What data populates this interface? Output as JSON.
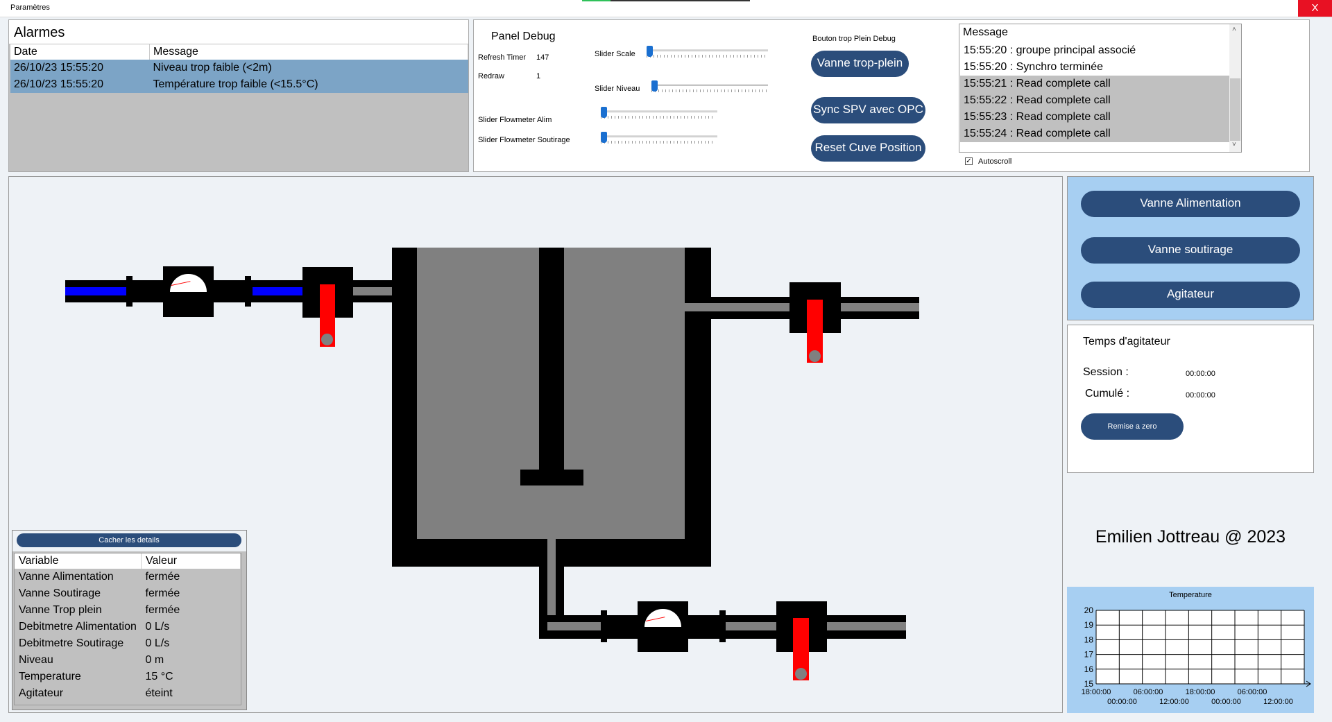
{
  "window": {
    "title": "Paramètres",
    "close_label": "X",
    "progress": 0.17
  },
  "alarms": {
    "title": "Alarmes",
    "columns": [
      "Date",
      "Message"
    ],
    "rows": [
      {
        "date": "26/10/23 15:55:20",
        "message": "Niveau trop faible (<2m)"
      },
      {
        "date": "26/10/23 15:55:20",
        "message": "Température trop faible (<15.5°C)"
      }
    ]
  },
  "debug": {
    "title": "Panel Debug",
    "refresh_timer_label": "Refresh Timer",
    "refresh_timer_value": "147",
    "redraw_label": "Redraw",
    "redraw_value": "1",
    "slider_scale_label": "Slider Scale",
    "slider_niveau_label": "Slider Niveau",
    "slider_alim_label": "Slider Flowmeter Alim",
    "slider_soutirage_label": "Slider Flowmeter Soutirage",
    "overflow_debug_label": "Bouton trop Plein Debug",
    "btn_overflow": "Vanne trop-plein",
    "btn_sync": "Sync SPV avec OPC",
    "btn_reset": "Reset Cuve Position"
  },
  "log": {
    "header": "Message",
    "rows": [
      {
        "text": "15:55:20 : groupe  principal associé",
        "selected": false
      },
      {
        "text": "15:55:20 : Synchro terminée",
        "selected": false
      },
      {
        "text": "15:55:21 : Read complete call",
        "selected": true
      },
      {
        "text": "15:55:22 : Read complete call",
        "selected": true
      },
      {
        "text": "15:55:23 : Read complete call",
        "selected": true
      },
      {
        "text": "15:55:24 : Read complete call",
        "selected": true
      }
    ],
    "autoscroll_label": "Autoscroll",
    "autoscroll_checked": true
  },
  "controls": {
    "btn_alimentation": "Vanne Alimentation",
    "btn_soutirage": "Vanne soutirage",
    "btn_agitateur": "Agitateur"
  },
  "agitator": {
    "title": "Temps d'agitateur",
    "session_label": "Session :",
    "session_value": "00:00:00",
    "cumul_label": "Cumulé :",
    "cumul_value": "00:00:00",
    "reset_btn": "Remise a zero"
  },
  "author": "Emilien Jottreau @ 2023",
  "details": {
    "toggle_btn": "Cacher les details",
    "columns": [
      "Variable",
      "Valeur"
    ],
    "rows": [
      {
        "variable": "Vanne Alimentation",
        "value": "fermée"
      },
      {
        "variable": "Vanne Soutirage",
        "value": "fermée"
      },
      {
        "variable": "Vanne Trop plein",
        "value": "fermée"
      },
      {
        "variable": "Debitmetre Alimentation",
        "value": "0 L/s"
      },
      {
        "variable": "Debitmetre Soutirage",
        "value": "0 L/s"
      },
      {
        "variable": "Niveau",
        "value": "0 m"
      },
      {
        "variable": "Temperature",
        "value": "15 °C"
      },
      {
        "variable": "Agitateur",
        "value": "éteint"
      }
    ]
  },
  "chart_data": {
    "type": "line",
    "title": "Temperature",
    "ylim": [
      15,
      20
    ],
    "y_ticks": [
      "20",
      "19",
      "18",
      "17",
      "16",
      "15"
    ],
    "x_ticks_top": [
      "18:00:00",
      "06:00:00",
      "18:00:00",
      "06:00:00"
    ],
    "x_ticks_bottom": [
      "00:00:00",
      "12:00:00",
      "00:00:00",
      "12:00:00"
    ],
    "series": [],
    "grid": true
  }
}
